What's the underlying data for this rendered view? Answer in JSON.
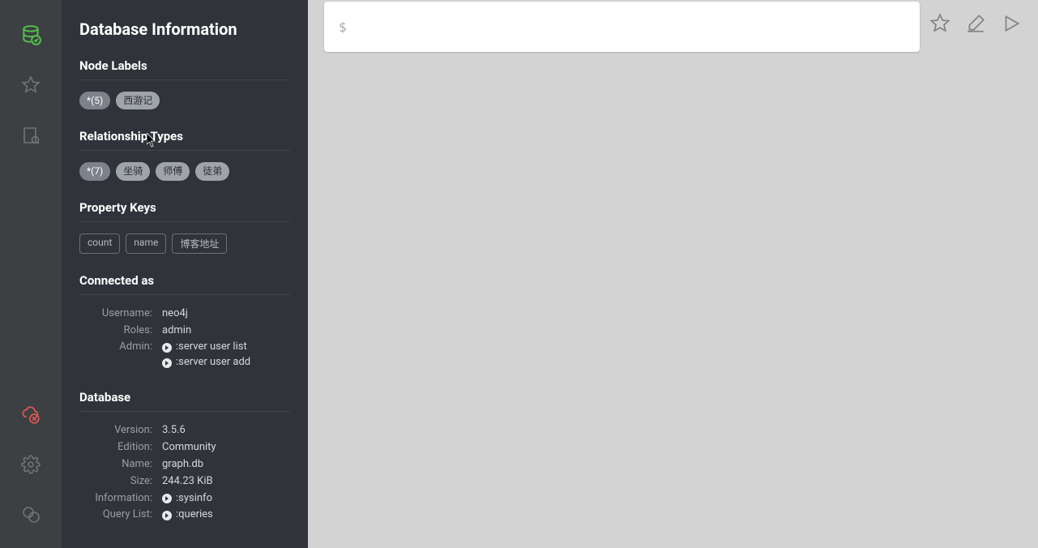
{
  "sidebar": {
    "title": "Database Information",
    "nodeLabelsHeading": "Node Labels",
    "nodeLabels": [
      "*(5)",
      "西游记"
    ],
    "relTypesHeading": "Relationship Types",
    "relTypes": [
      "*(7)",
      "坐骑",
      "师傅",
      "徒弟"
    ],
    "propKeysHeading": "Property Keys",
    "propKeys": [
      "count",
      "name",
      "博客地址"
    ],
    "connectedHeading": "Connected as",
    "connected": {
      "usernameLabel": "Username:",
      "username": "neo4j",
      "rolesLabel": "Roles:",
      "roles": "admin",
      "adminLabel": "Admin:",
      "cmdUserList": ":server user list",
      "cmdUserAdd": ":server user add"
    },
    "databaseHeading": "Database",
    "database": {
      "versionLabel": "Version:",
      "version": "3.5.6",
      "editionLabel": "Edition:",
      "edition": "Community",
      "nameLabel": "Name:",
      "name": "graph.db",
      "sizeLabel": "Size:",
      "size": "244.23 KiB",
      "infoLabel": "Information:",
      "cmdSysinfo": ":sysinfo",
      "queryListLabel": "Query List:",
      "cmdQueries": ":queries"
    }
  },
  "editor": {
    "prompt": "$",
    "value": ""
  }
}
